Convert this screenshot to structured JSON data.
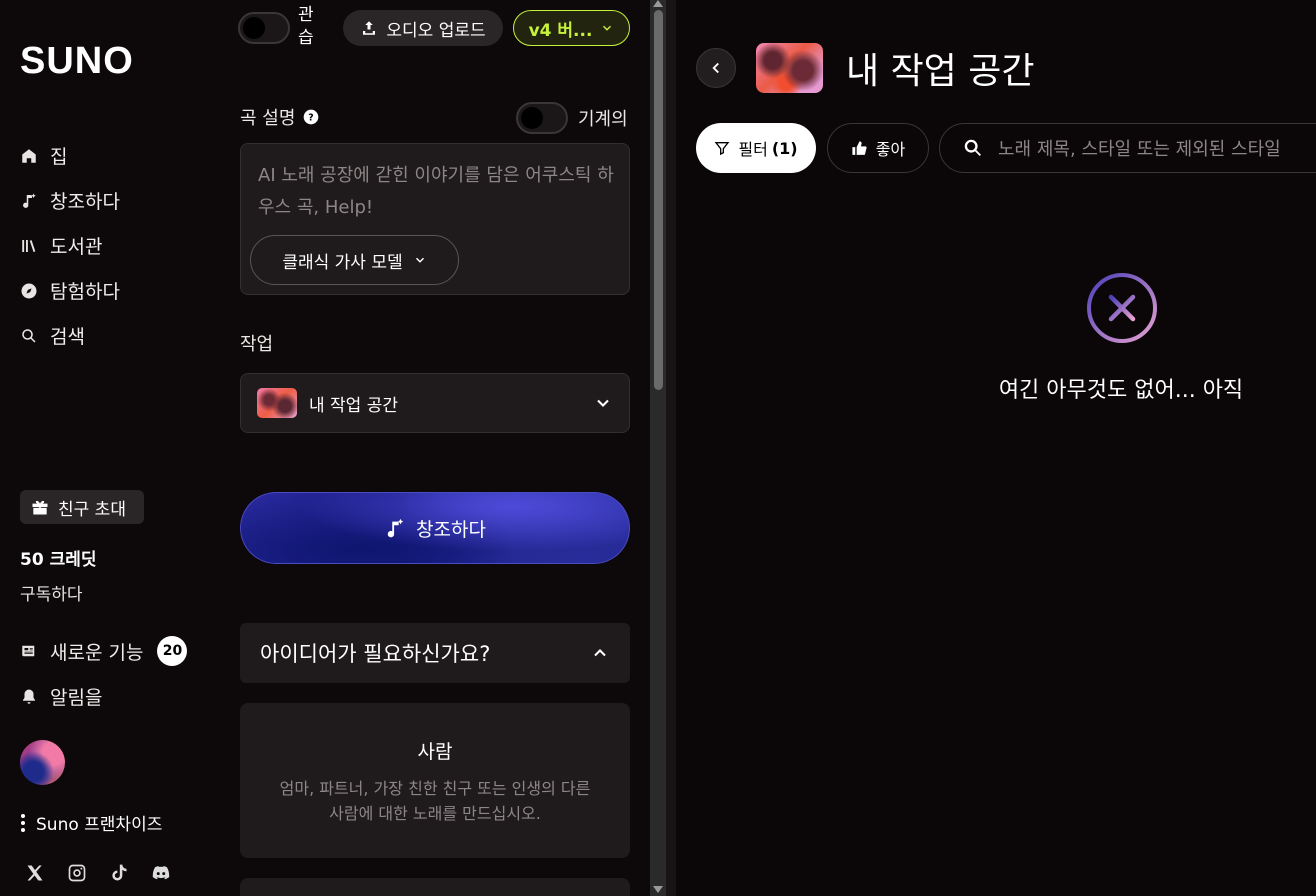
{
  "sidebar": {
    "logo": "SUNO",
    "nav": [
      {
        "label": "집",
        "icon": "home-icon"
      },
      {
        "label": "창조하다",
        "icon": "music-create-icon"
      },
      {
        "label": "도서관",
        "icon": "library-icon"
      },
      {
        "label": "탐험하다",
        "icon": "compass-icon"
      },
      {
        "label": "검색",
        "icon": "search-icon"
      }
    ],
    "invite_label": "친구 초대",
    "credits": "50 크레딧",
    "subscribe": "구독하다",
    "whats_new": "새로운 기능",
    "whats_new_count": "20",
    "notifications": "알림을",
    "franchise": "Suno 프랜차이즈"
  },
  "create": {
    "instrumental_label": "기계의",
    "practice_label_1": "관",
    "practice_label_2": "습",
    "upload_audio": "오디오 업로드",
    "version": "v4 버...",
    "song_description_label": "곡 설명",
    "description_placeholder": "AI 노래 공장에 갇힌 이야기를 담은 어쿠스틱 하우스 곡, Help!",
    "lyric_model": "클래식 가사 모델",
    "workspace_label": "작업",
    "workspace_value": "내 작업 공간",
    "create_button": "창조하다",
    "ideas_header": "아이디어가 필요하신가요?",
    "idea_title": "사람",
    "idea_desc": "엄마, 파트너, 가장 친한 친구 또는 인생의 다른 사람에 대한 노래를 만드십시오."
  },
  "workspace": {
    "title": "내 작업 공간",
    "filter_label": "필터",
    "filter_count": "(1)",
    "like_label": "좋아",
    "search_placeholder": "노래 제목, 스타일 또는 제외된 스타일",
    "empty_message": "여긴 아무것도 없어... 아직"
  },
  "colors": {
    "background": "#0b0708",
    "accent_version": "#c6f13d",
    "create_gradient": "#2b2aa1",
    "empty_icon_gradient_start": "#4a3fb8",
    "empty_icon_gradient_end": "#e7a2d2"
  }
}
